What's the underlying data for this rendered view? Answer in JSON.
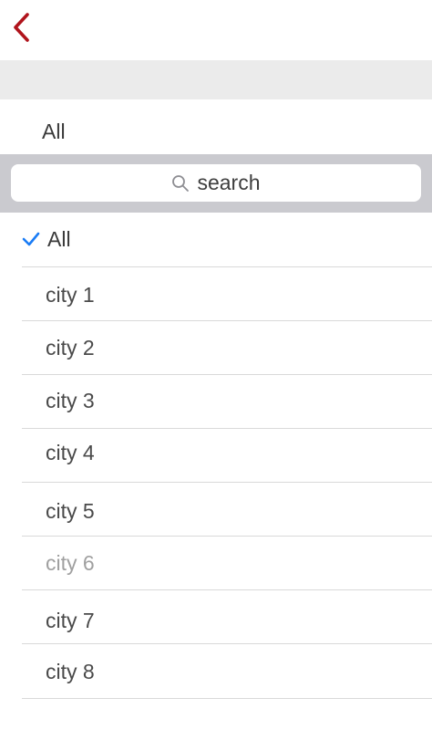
{
  "nav": {
    "back_icon": "chevron-left-icon",
    "accent": "#b0141c"
  },
  "current_selection": "All",
  "search": {
    "placeholder": "search"
  },
  "items": [
    {
      "label": "All",
      "selected": true
    },
    {
      "label": "city 1"
    },
    {
      "label": "city 2"
    },
    {
      "label": "city 3"
    },
    {
      "label": "city 4"
    },
    {
      "label": "city 5"
    },
    {
      "label": "city 6",
      "muted": true
    },
    {
      "label": "city 7"
    },
    {
      "label": "city 8"
    }
  ],
  "colors": {
    "checkmark": "#1a7cf5"
  }
}
